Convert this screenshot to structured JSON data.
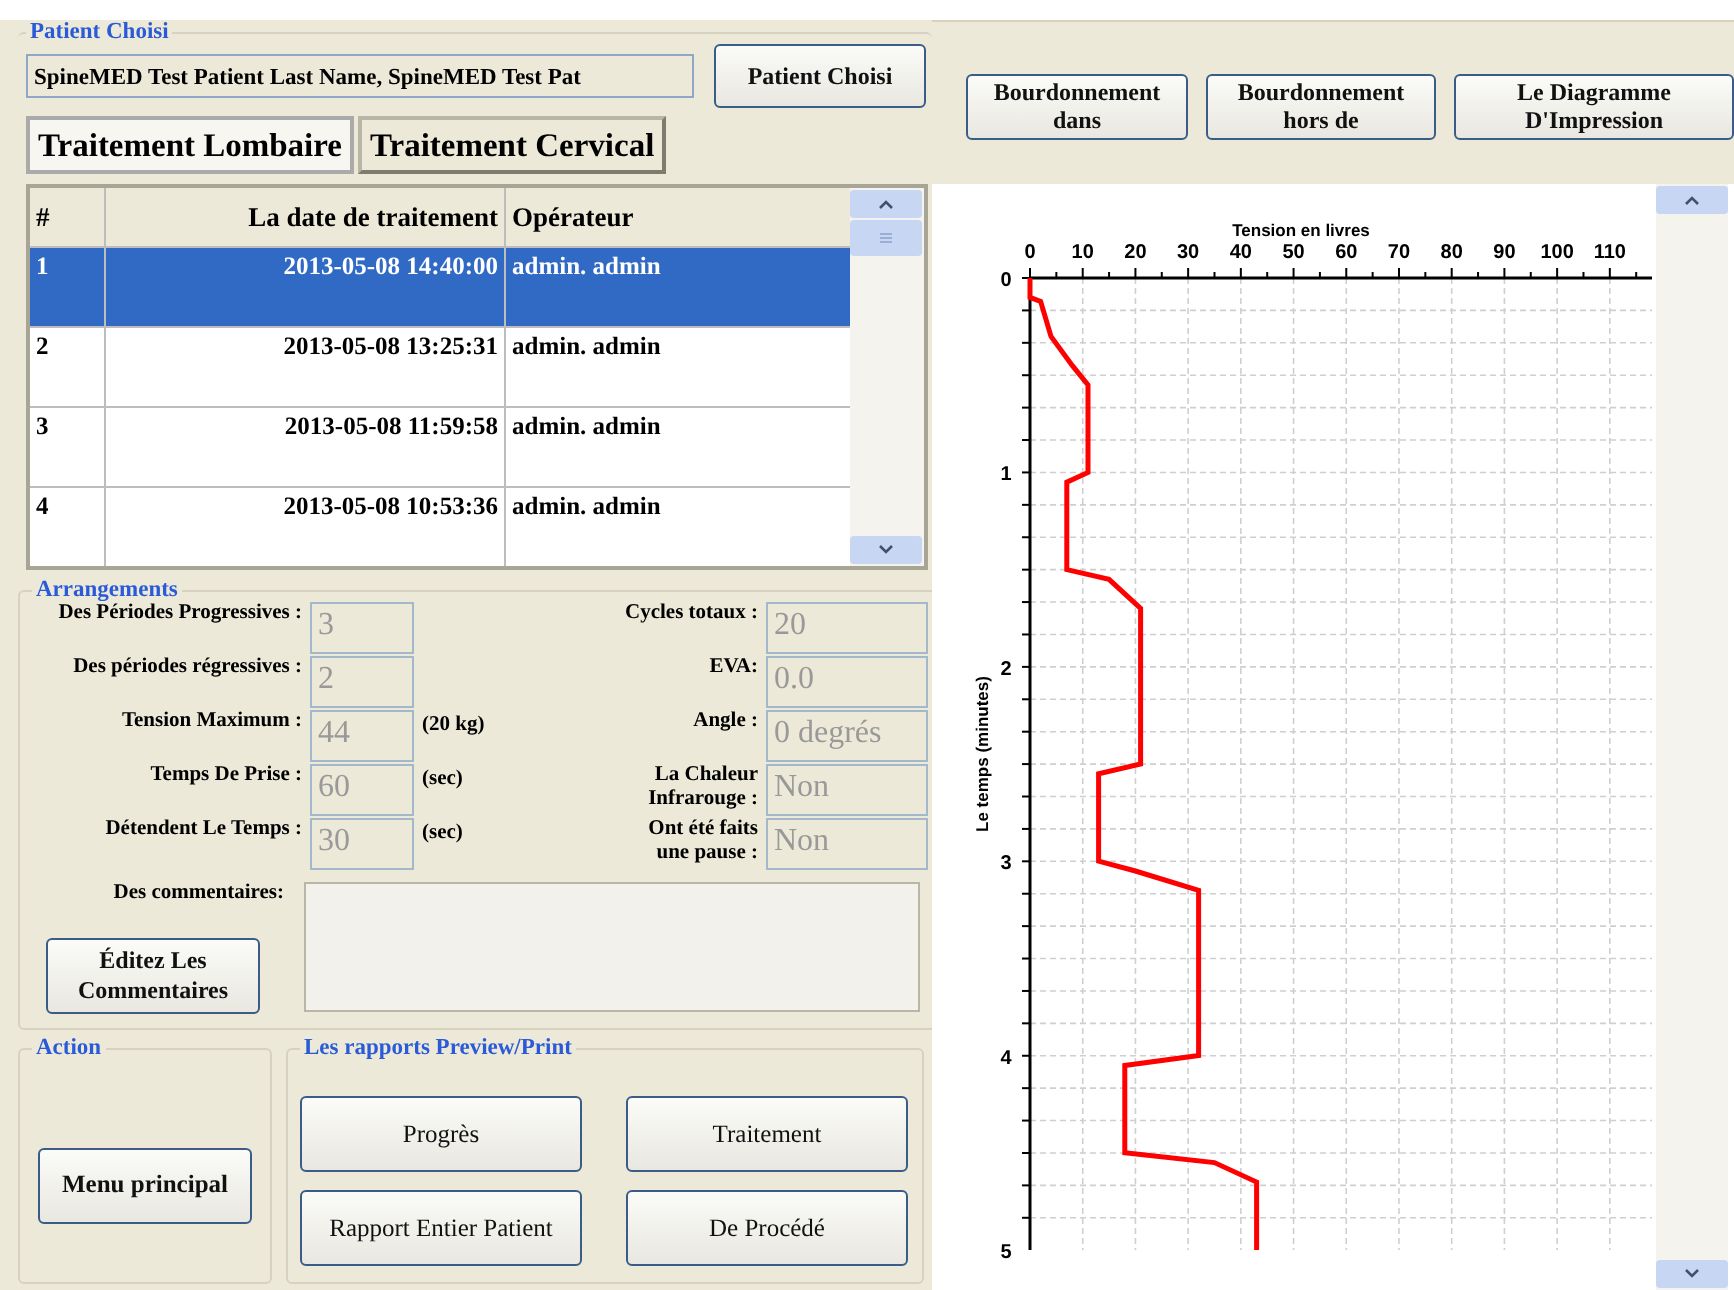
{
  "patient": {
    "legend": "Patient Choisi",
    "name_value": "SpineMED Test Patient Last Name, SpineMED Test Pat",
    "button": "Patient Choisi"
  },
  "treatment_tabs": [
    {
      "label": "Traitement Lombaire",
      "selected": true
    },
    {
      "label": "Traitement Cervical",
      "selected": false
    }
  ],
  "table": {
    "columns": [
      "#",
      "La date de traitement",
      "Opérateur"
    ],
    "rows": [
      {
        "cells": [
          "1",
          "2013-05-08 14:40:00",
          "admin. admin"
        ],
        "selected": true
      },
      {
        "cells": [
          "2",
          "2013-05-08 13:25:31",
          "admin. admin"
        ],
        "selected": false
      },
      {
        "cells": [
          "3",
          "2013-05-08 11:59:58",
          "admin. admin"
        ],
        "selected": false
      },
      {
        "cells": [
          "4",
          "2013-05-08 10:53:36",
          "admin. admin"
        ],
        "selected": false
      }
    ]
  },
  "settings": {
    "legend": "Arrangements",
    "rows": [
      {
        "label": "Des Périodes Progressives :",
        "value": "3",
        "label_2": "Cycles totaux :",
        "value_2": "20"
      },
      {
        "label": "Des périodes régressives :",
        "value": "2",
        "label_2": "EVA:",
        "value_2": "0.0"
      },
      {
        "label": "Tension Maximum :",
        "value": "44",
        "unit": "(20 kg)",
        "label_2": "Angle :",
        "value_2": "0 degrés"
      },
      {
        "label": "Temps De Prise :",
        "value": "60",
        "unit": "(sec)",
        "label_2": "La Chaleur Infrarouge :",
        "value_2": "Non"
      },
      {
        "label": "Détendent Le Temps :",
        "value": "30",
        "unit": "(sec)",
        "label_2": "Ont été faits une pause :",
        "value_2": "Non"
      }
    ],
    "comments_label": "Des commentaires:",
    "edit_button": "Éditez Les Commentaires"
  },
  "action": {
    "legend": "Action",
    "button": "Menu principal"
  },
  "reports": {
    "legend": "Les rapports Preview/Print",
    "buttons": [
      "Progrès",
      "Traitement",
      "Rapport Entier Patient",
      "De Procédé"
    ]
  },
  "chart_buttons": [
    "Bourdonnement dans",
    "Bourdonnement hors de",
    "Le Diagramme D'Impression"
  ],
  "chart": {
    "chart_data": {
      "type": "line",
      "grid": true,
      "xlabel": "Tension en livres",
      "ylabel": "Le temps (minutes)",
      "x": [
        0,
        0,
        2,
        4,
        8,
        11,
        11,
        7,
        7,
        15,
        21,
        21,
        13,
        13,
        20,
        32,
        32,
        18,
        18,
        35,
        43,
        43
      ],
      "series": [
        {
          "color": "#ff0000",
          "values": [
            0,
            0.1,
            0.12,
            0.3,
            0.45,
            0.55,
            1.0,
            1.05,
            1.5,
            1.55,
            1.7,
            2.5,
            2.55,
            3.0,
            3.05,
            3.15,
            4.0,
            4.05,
            4.5,
            4.55,
            4.65,
            5.0
          ]
        }
      ],
      "xlim": [
        0,
        118
      ],
      "ylim": [
        5,
        0
      ],
      "xticks": [
        0,
        10,
        20,
        30,
        40,
        50,
        60,
        70,
        80,
        90,
        100,
        110
      ],
      "yticks": [
        0,
        1,
        2,
        3,
        4,
        5
      ]
    }
  }
}
